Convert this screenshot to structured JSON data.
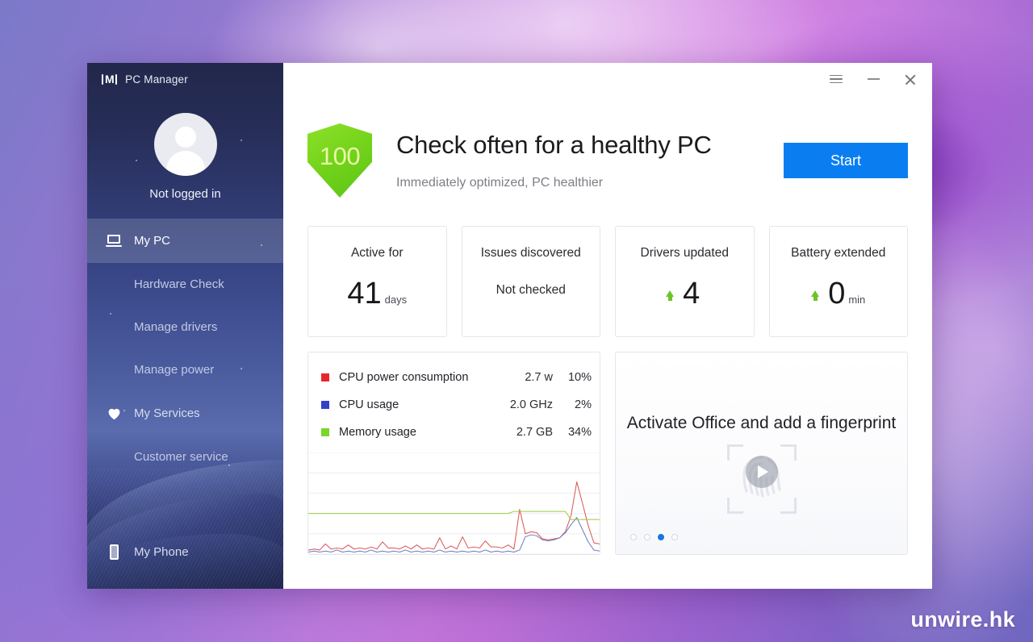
{
  "desktop": {
    "watermark": "unwire.hk"
  },
  "window": {
    "app_title": "PC Manager",
    "logo_icon": "pc-manager-logo",
    "controls": {
      "menu_label": "hamburger-menu-icon",
      "minimize_label": "minimize-icon",
      "close_label": "close-icon"
    }
  },
  "sidebar": {
    "profile": {
      "avatar_icon": "user-avatar",
      "status": "Not logged in"
    },
    "items": [
      {
        "label": "My PC",
        "icon": "laptop-icon",
        "active": true,
        "sub": false
      },
      {
        "label": "Hardware Check",
        "icon": "",
        "active": false,
        "sub": true
      },
      {
        "label": "Manage drivers",
        "icon": "",
        "active": false,
        "sub": true
      },
      {
        "label": "Manage power",
        "icon": "",
        "active": false,
        "sub": true
      },
      {
        "label": "My Services",
        "icon": "heart-icon",
        "active": false,
        "sub": false
      },
      {
        "label": "Customer service",
        "icon": "",
        "active": false,
        "sub": true
      }
    ],
    "bottom_item": {
      "label": "My Phone",
      "icon": "phone-icon"
    }
  },
  "hero": {
    "score": "100",
    "score_shield_color": "#74d41b",
    "title": "Check often for a healthy PC",
    "subtitle": "Immediately optimized, PC healthier",
    "start_button": "Start",
    "start_button_color": "#0a7ef0"
  },
  "stats": [
    {
      "label": "Active for",
      "value": "41",
      "unit": "days",
      "arrow": false,
      "plain": ""
    },
    {
      "label": "Issues discovered",
      "value": "",
      "unit": "",
      "arrow": false,
      "plain": "Not checked"
    },
    {
      "label": "Drivers updated",
      "value": "4",
      "unit": "",
      "arrow": true,
      "plain": ""
    },
    {
      "label": "Battery extended",
      "value": "0",
      "unit": "min",
      "arrow": true,
      "plain": ""
    }
  ],
  "performance": {
    "metrics": [
      {
        "name": "CPU power consumption",
        "value": "2.7 w",
        "percent": "10%",
        "color": "#e8262a"
      },
      {
        "name": "CPU usage",
        "value": "2.0 GHz",
        "percent": "2%",
        "color": "#3340c8"
      },
      {
        "name": "Memory usage",
        "value": "2.7 GB",
        "percent": "34%",
        "color": "#7bd62a"
      }
    ]
  },
  "chart_data": {
    "type": "line",
    "title": "",
    "xlabel": "",
    "ylabel": "",
    "ylim": [
      0,
      100
    ],
    "grid": true,
    "gridlines": [
      0,
      20,
      40,
      60,
      80,
      100
    ],
    "legend_position": "top",
    "series": [
      {
        "name": "CPU power consumption",
        "color": "#d9534f",
        "values": [
          4,
          5,
          4,
          10,
          5,
          6,
          5,
          9,
          5,
          6,
          5,
          7,
          5,
          12,
          6,
          6,
          5,
          8,
          5,
          9,
          5,
          6,
          5,
          16,
          5,
          8,
          5,
          17,
          6,
          7,
          6,
          13,
          7,
          7,
          6,
          9,
          5,
          44,
          20,
          22,
          21,
          15,
          14,
          15,
          16,
          22,
          38,
          71,
          50,
          28,
          11,
          10
        ]
      },
      {
        "name": "CPU usage",
        "color": "#6a7bbf",
        "values": [
          2,
          3,
          2,
          3,
          2,
          4,
          2,
          3,
          2,
          3,
          2,
          4,
          2,
          3,
          2,
          3,
          2,
          4,
          2,
          3,
          2,
          3,
          2,
          4,
          2,
          3,
          2,
          3,
          2,
          3,
          2,
          4,
          2,
          3,
          2,
          3,
          2,
          4,
          17,
          19,
          18,
          14,
          13,
          14,
          16,
          21,
          29,
          36,
          24,
          12,
          4,
          3
        ]
      },
      {
        "name": "Memory usage",
        "color": "#9ccb3b",
        "values": [
          40,
          40,
          40,
          40,
          40,
          40,
          40,
          40,
          40,
          40,
          40,
          40,
          40,
          40,
          40,
          40,
          40,
          40,
          40,
          40,
          40,
          40,
          40,
          40,
          40,
          40,
          40,
          40,
          40,
          40,
          40,
          40,
          40,
          40,
          40,
          40,
          42,
          42,
          42,
          42,
          42,
          42,
          42,
          42,
          42,
          42,
          34,
          34,
          34,
          34,
          34,
          34
        ]
      }
    ]
  },
  "promo": {
    "title": "Activate Office and add a fingerprint",
    "art_icon": "fingerprint-scan-icon",
    "play_icon": "play-button-icon",
    "dots": [
      false,
      false,
      true,
      false
    ],
    "active_dot_color": "#1577e0"
  }
}
